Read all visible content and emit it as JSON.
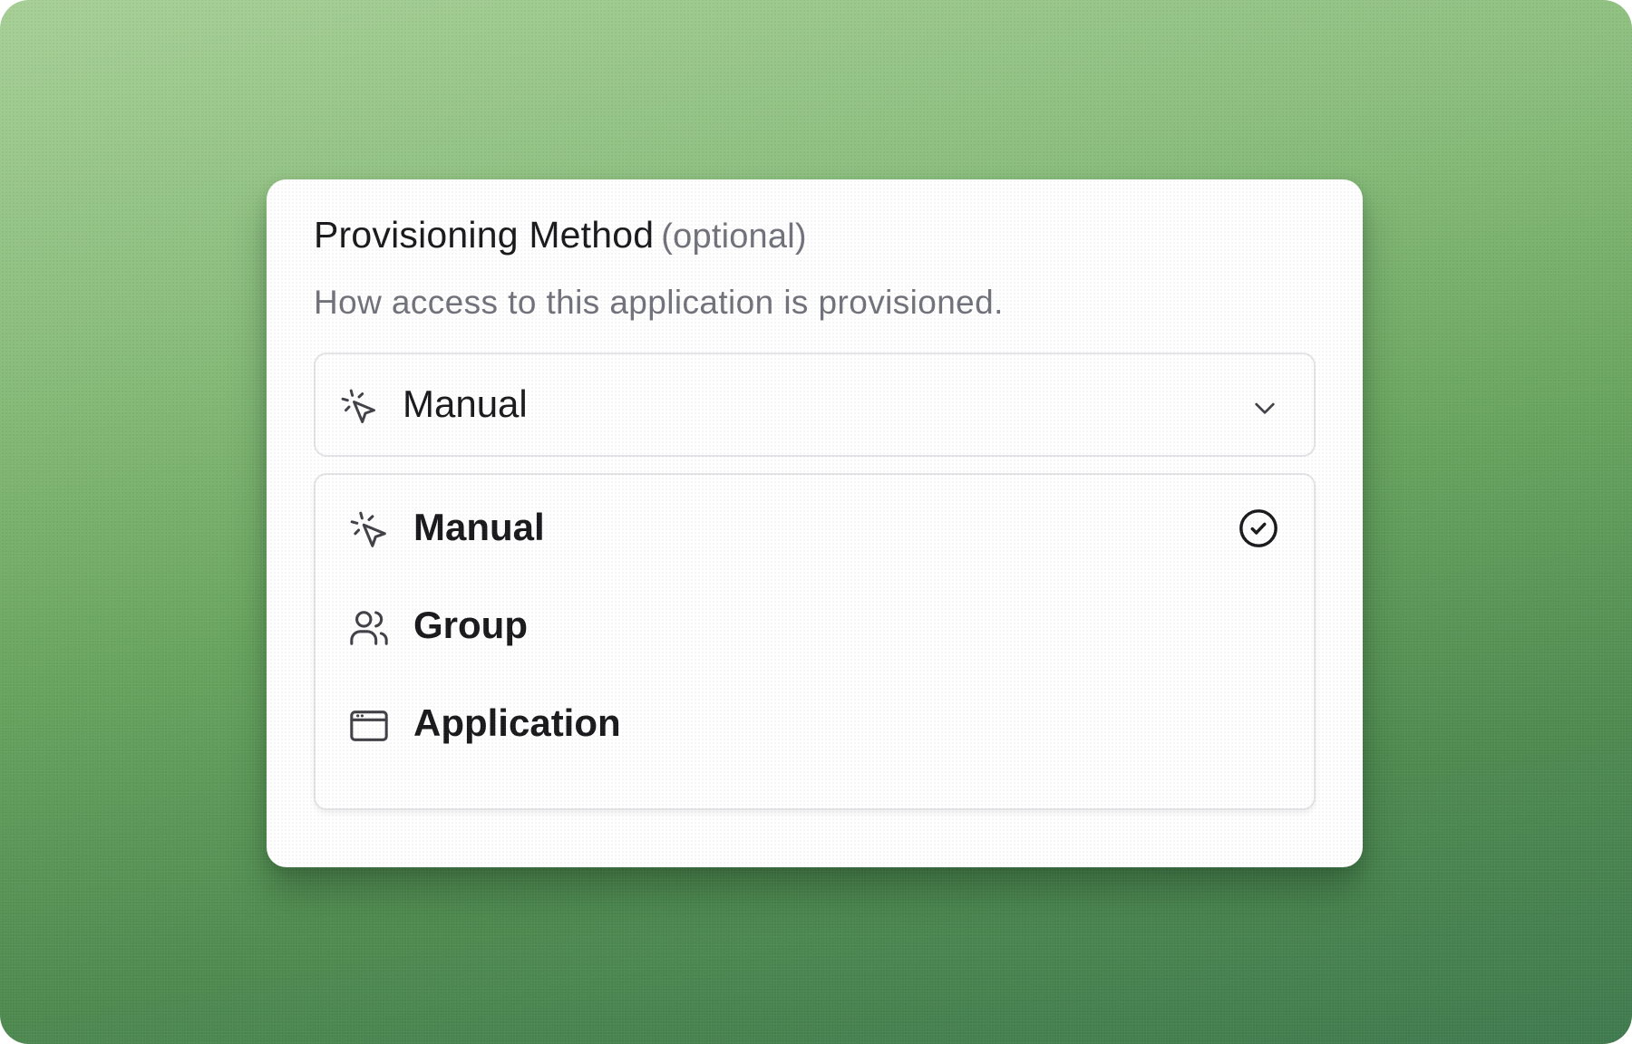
{
  "field": {
    "label": "Provisioning Method",
    "optional": "(optional)",
    "description": "How access to this application is provisioned."
  },
  "select": {
    "value": "Manual",
    "icon": "pointer-click-icon"
  },
  "menu": {
    "items": [
      {
        "label": "Manual",
        "icon": "pointer-click-icon",
        "selected": true
      },
      {
        "label": "Group",
        "icon": "users-icon",
        "selected": false
      },
      {
        "label": "Application",
        "icon": "app-window-icon",
        "selected": false
      }
    ]
  },
  "colors": {
    "text_primary": "#18181b",
    "text_muted": "#71717a",
    "border": "#e4e4e7",
    "background_green": "#6aa660"
  }
}
